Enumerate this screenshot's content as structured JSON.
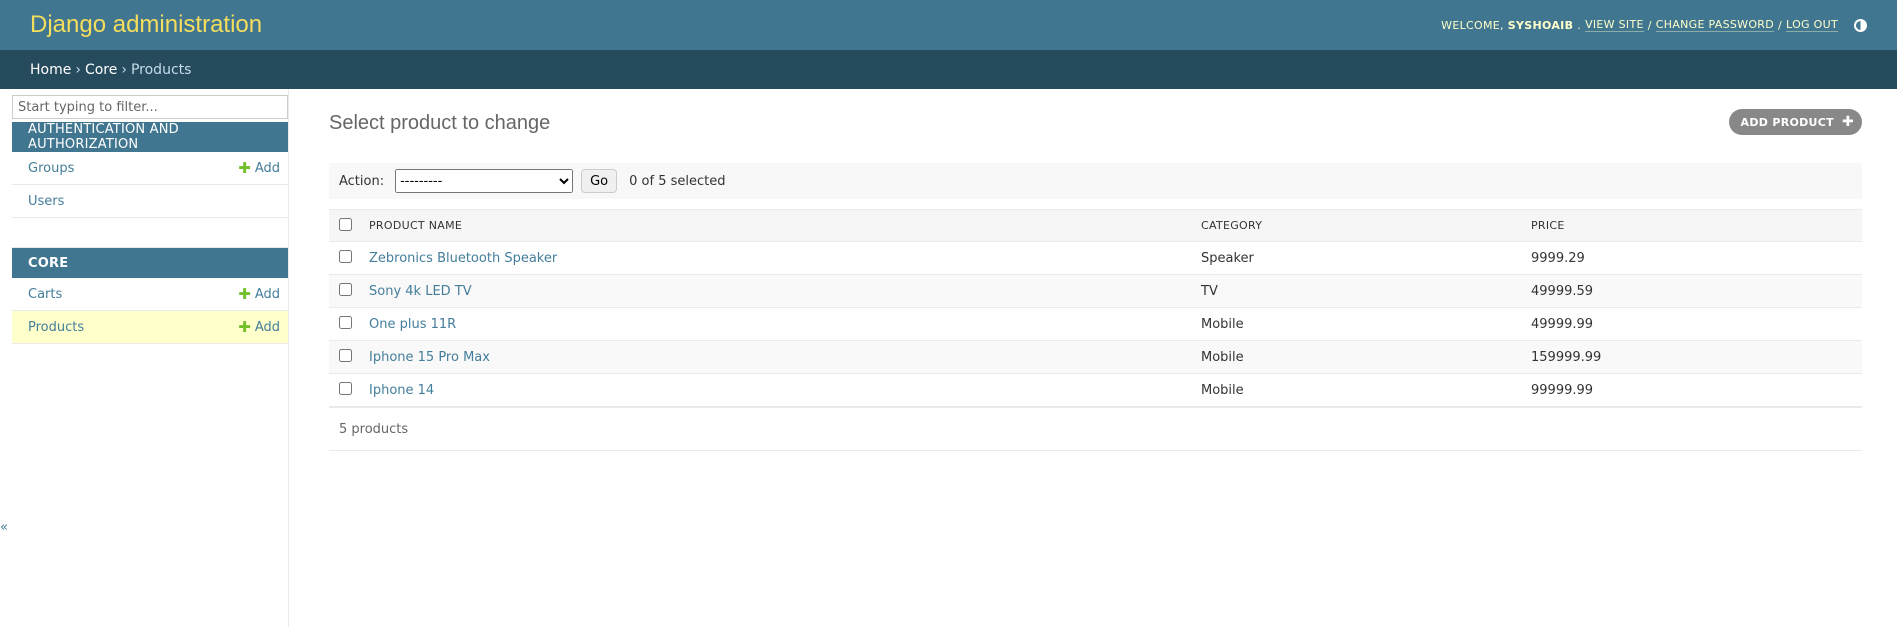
{
  "header": {
    "branding": "Django administration",
    "welcome": "WELCOME,",
    "username": "SYSHOAIB",
    "period": ".",
    "view_site": "VIEW SITE",
    "slash1": "/",
    "change_password": "CHANGE PASSWORD",
    "slash2": "/",
    "log_out": "LOG OUT",
    "theme_icon": "contrast-half-circle-icon"
  },
  "breadcrumbs": {
    "home": "Home",
    "sep": "›",
    "app": "Core",
    "current": "Products"
  },
  "sidebar": {
    "filter_placeholder": "Start typing to filter...",
    "modules": [
      {
        "caption": "AUTHENTICATION AND AUTHORIZATION",
        "rows": [
          {
            "label": "Groups",
            "add": "Add"
          },
          {
            "label": "Users"
          }
        ]
      },
      {
        "caption": "CORE",
        "rows": [
          {
            "label": "Carts",
            "add": "Add"
          },
          {
            "label": "Products",
            "add": "Add"
          }
        ]
      }
    ],
    "collapse_glyph": "«"
  },
  "content": {
    "title": "Select product to change",
    "add_button": "ADD PRODUCT",
    "action_label": "Action:",
    "action_selected": "---------",
    "go": "Go",
    "selected_count": "0 of 5 selected",
    "columns": [
      "PRODUCT NAME",
      "CATEGORY",
      "PRICE"
    ],
    "rows": [
      {
        "name": "Zebronics Bluetooth Speaker",
        "category": "Speaker",
        "price": "9999.29"
      },
      {
        "name": "Sony 4k LED TV",
        "category": "TV",
        "price": "49999.59"
      },
      {
        "name": "One plus 11R",
        "category": "Mobile",
        "price": "49999.99"
      },
      {
        "name": "Iphone 15 Pro Max",
        "category": "Mobile",
        "price": "159999.99"
      },
      {
        "name": "Iphone 14",
        "category": "Mobile",
        "price": "99999.99"
      }
    ],
    "paginator": "5 products"
  },
  "colors": {
    "header_bg": "#417690",
    "breadcrumb_bg": "#264b5d",
    "branding": "#f5dd5d",
    "link": "#447e9b",
    "add_plus": "#70bf2b",
    "current_row": "#ffffcc"
  }
}
